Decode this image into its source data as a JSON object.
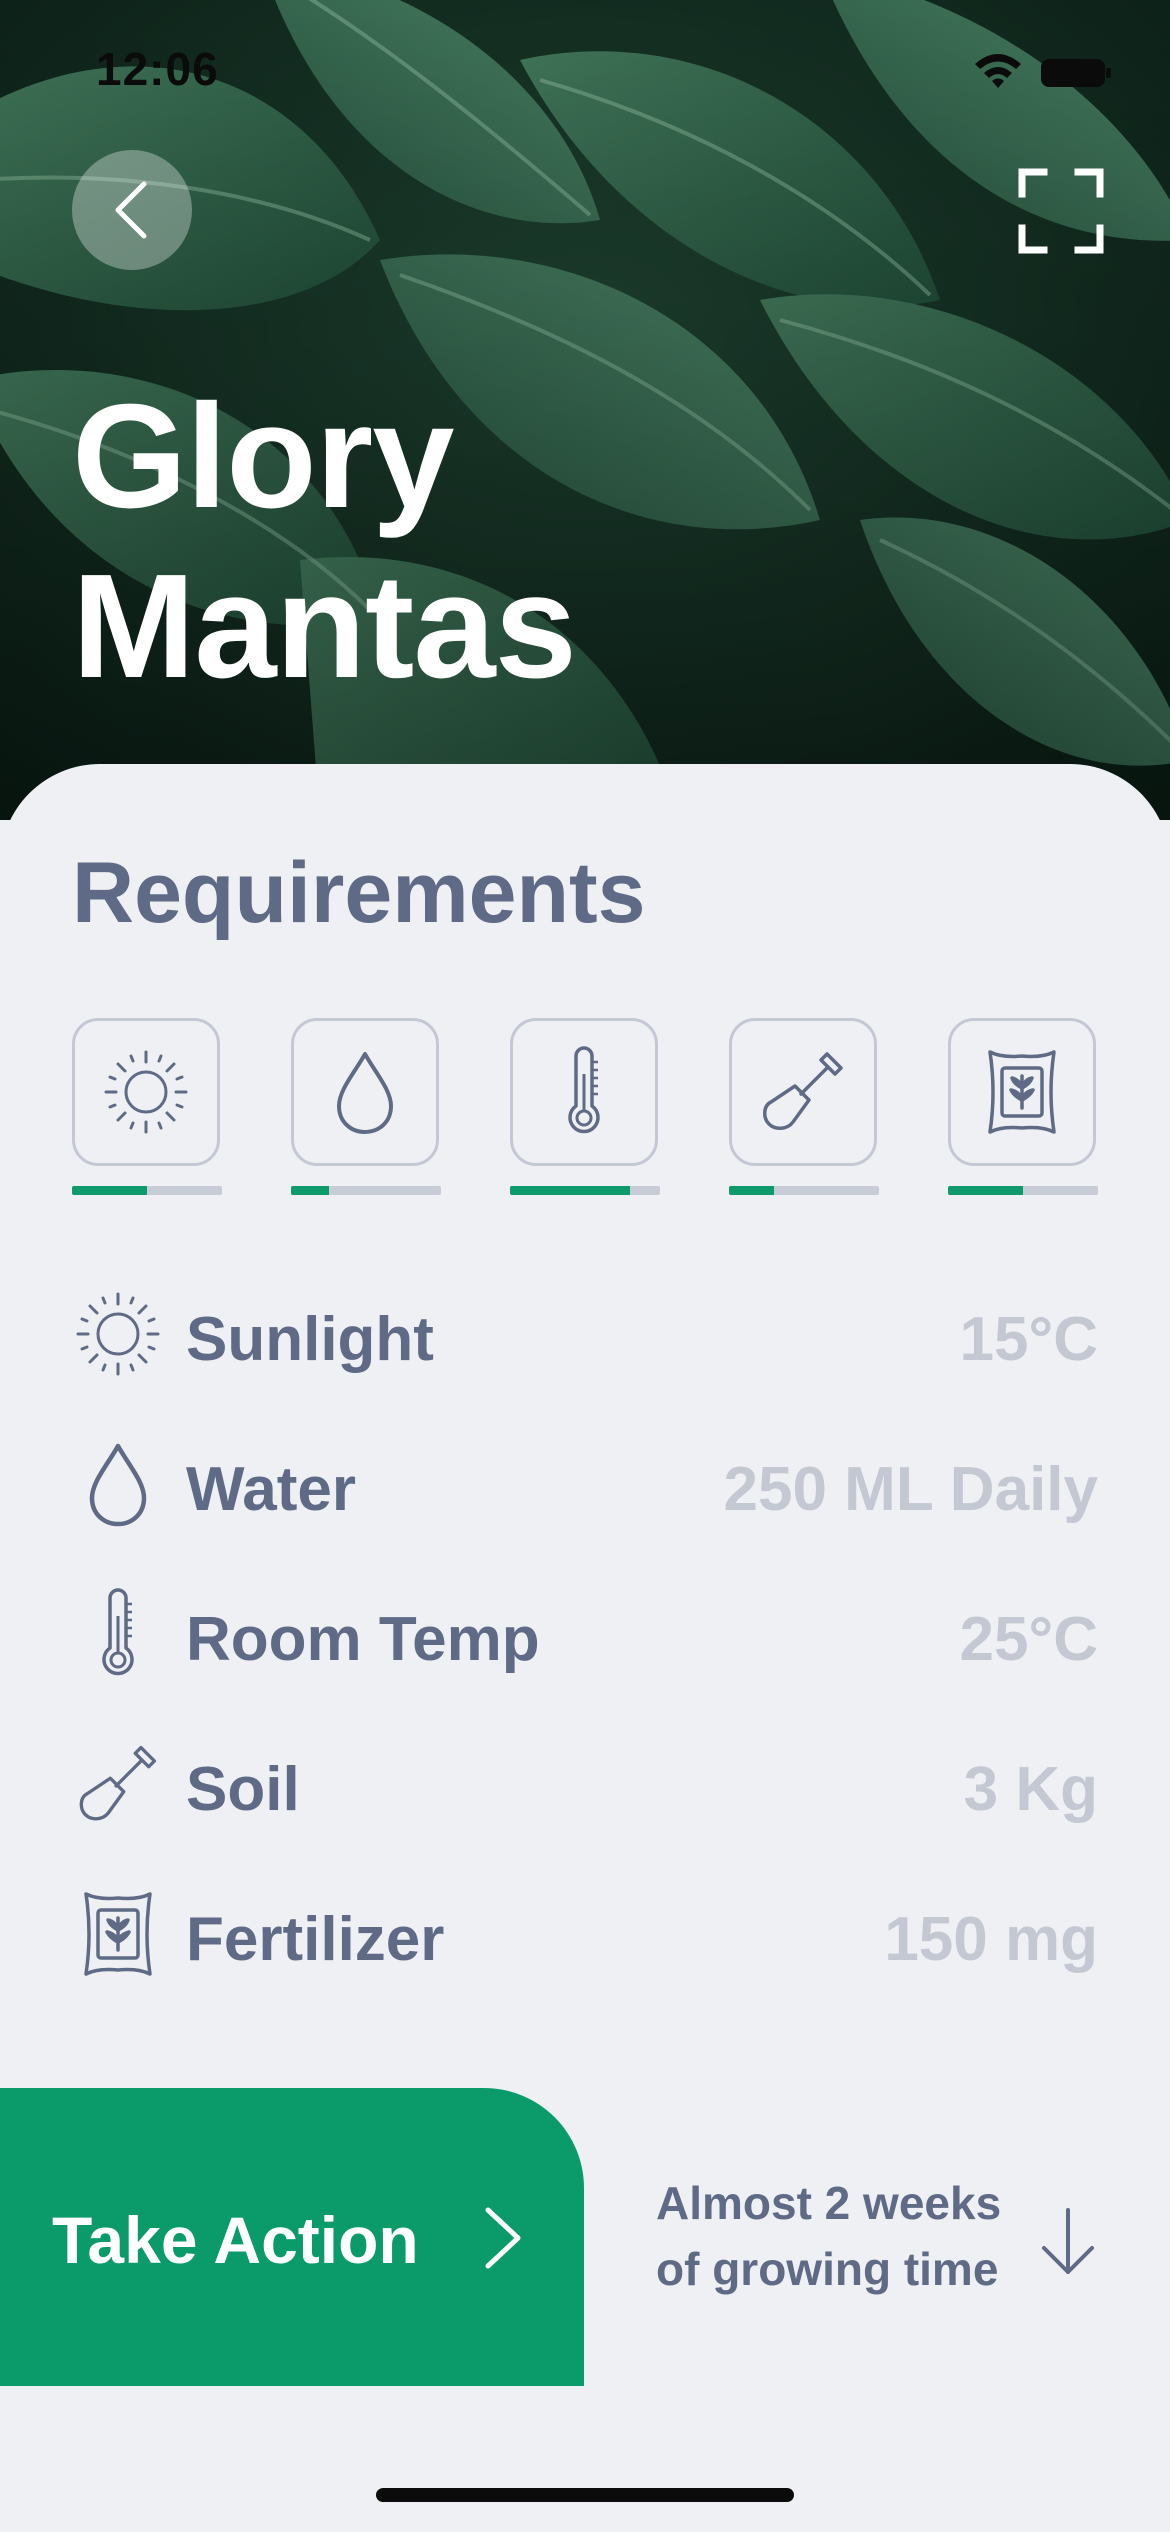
{
  "status_bar": {
    "time": "12:06"
  },
  "plant": {
    "name_line1": "Glory",
    "name_line2": "Mantas"
  },
  "requirements": {
    "title": "Requirements",
    "items": [
      {
        "label": "Sunlight",
        "value": "15°C",
        "icon": "sun-icon",
        "level": 0.5
      },
      {
        "label": "Water",
        "value": "250 ML Daily",
        "icon": "water-drop-icon",
        "level": 0.25
      },
      {
        "label": "Room Temp",
        "value": "25°C",
        "icon": "thermometer-icon",
        "level": 0.8
      },
      {
        "label": "Soil",
        "value": "3 Kg",
        "icon": "shovel-icon",
        "level": 0.3
      },
      {
        "label": "Fertilizer",
        "value": "150 mg",
        "icon": "fertilizer-bag-icon",
        "level": 0.5
      }
    ]
  },
  "action": {
    "take_action_label": "Take Action",
    "growing_time_line1": "Almost 2 weeks",
    "growing_time_line2": "of growing time"
  },
  "colors": {
    "accent": "#0b9b6a",
    "text_primary": "#5f6b86",
    "text_muted": "#c4c8d3",
    "sheet_background": "#eef0f3"
  }
}
